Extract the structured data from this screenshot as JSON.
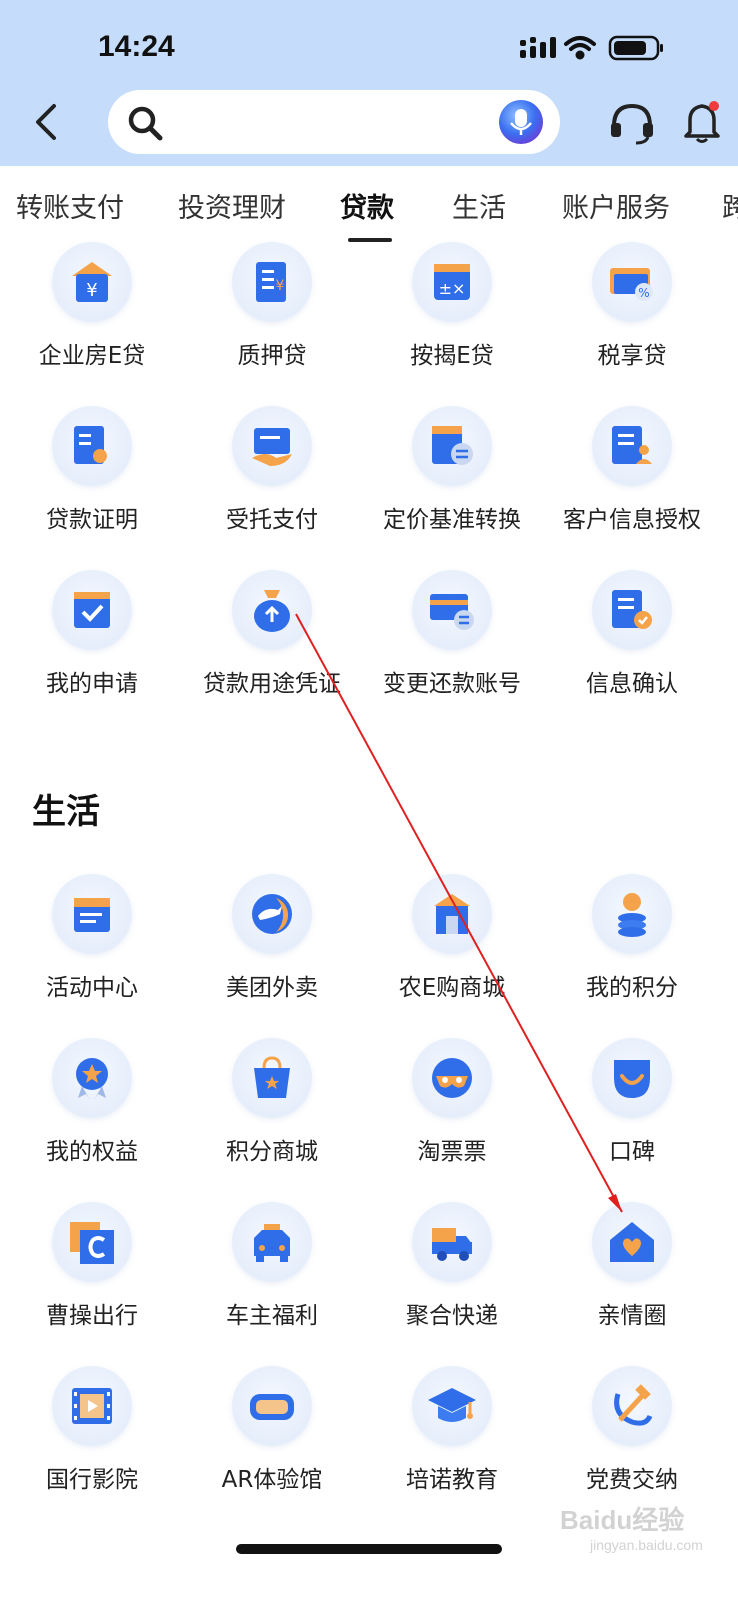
{
  "status_bar": {
    "time": "14:24"
  },
  "tabs": [
    "转账支付",
    "投资理财",
    "贷款",
    "生活",
    "账户服务",
    "跨"
  ],
  "loan_items": [
    {
      "label": "企业房E贷",
      "icon": "house-money-icon"
    },
    {
      "label": "质押贷",
      "icon": "pledge-document-icon"
    },
    {
      "label": "按揭E贷",
      "icon": "calculator-icon"
    },
    {
      "label": "税享贷",
      "icon": "tax-card-icon"
    },
    {
      "label": "贷款证明",
      "icon": "certificate-icon"
    },
    {
      "label": "受托支付",
      "icon": "hand-payment-icon"
    },
    {
      "label": "定价基准转换",
      "icon": "pricing-switch-icon"
    },
    {
      "label": "客户信息授权",
      "icon": "customer-info-icon"
    },
    {
      "label": "我的申请",
      "icon": "application-check-icon"
    },
    {
      "label": "贷款用途凭证",
      "icon": "money-bag-upload-icon"
    },
    {
      "label": "变更还款账号",
      "icon": "card-switch-icon"
    },
    {
      "label": "信息确认",
      "icon": "document-confirm-icon"
    }
  ],
  "life_section": {
    "title": "生活",
    "items": [
      {
        "label": "活动中心",
        "icon": "calendar-icon"
      },
      {
        "label": "美团外卖",
        "icon": "meituan-kangaroo-icon"
      },
      {
        "label": "农E购商城",
        "icon": "store-icon"
      },
      {
        "label": "我的积分",
        "icon": "points-coins-icon"
      },
      {
        "label": "我的权益",
        "icon": "star-badge-icon"
      },
      {
        "label": "积分商城",
        "icon": "shopping-bag-icon"
      },
      {
        "label": "淘票票",
        "icon": "taopiaopiao-icon"
      },
      {
        "label": "口碑",
        "icon": "koubei-smile-icon"
      },
      {
        "label": "曹操出行",
        "icon": "caocao-c-icon"
      },
      {
        "label": "车主福利",
        "icon": "car-icon"
      },
      {
        "label": "聚合快递",
        "icon": "delivery-truck-icon"
      },
      {
        "label": "亲情圈",
        "icon": "family-heart-house-icon"
      },
      {
        "label": "国行影院",
        "icon": "film-icon"
      },
      {
        "label": "AR体验馆",
        "icon": "vr-goggles-icon"
      },
      {
        "label": "培诺教育",
        "icon": "graduation-cap-icon"
      },
      {
        "label": "党费交纳",
        "icon": "party-emblem-icon"
      }
    ]
  },
  "watermark": {
    "brand": "Baidu经验",
    "url": "jingyan.baidu.com"
  },
  "colors": {
    "header_bg": "#c6dcfb",
    "accent_blue": "#2f6ee8",
    "accent_orange": "#f5a34a",
    "annotation_red": "#e02020"
  }
}
